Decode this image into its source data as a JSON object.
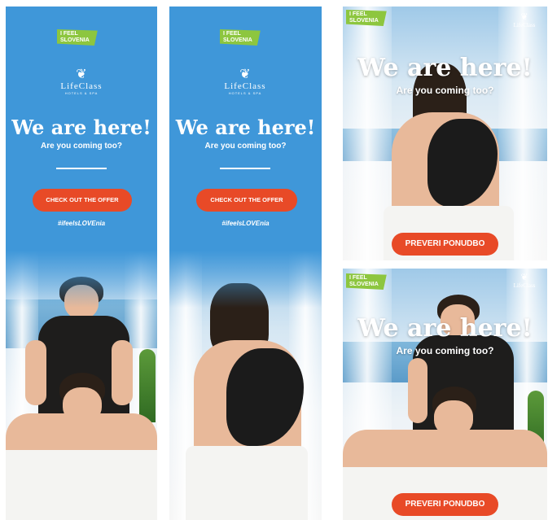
{
  "brand": {
    "feel_line1": "I FEEL",
    "feel_line2": "SLOVENIA",
    "lifeclass_name": "LifeClass",
    "lifeclass_sub": "HOTELS & SPA",
    "lifeclass_symbol": "❦"
  },
  "copy": {
    "headline": "We are here!",
    "subline": "Are you coming too?",
    "hashtag": "#ifeelsLOVEnia",
    "cta_en": "CHECK OUT THE OFFER",
    "cta_sl": "PREVERI PONUDBO"
  },
  "colors": {
    "sky_blue": "#3f97d9",
    "cta_red": "#e84a27",
    "slovenia_green": "#8dc63f"
  },
  "banners": [
    {
      "id": "skyscraper-massage"
    },
    {
      "id": "skyscraper-mud-back"
    },
    {
      "id": "square-mud-back"
    },
    {
      "id": "square-massage"
    }
  ]
}
